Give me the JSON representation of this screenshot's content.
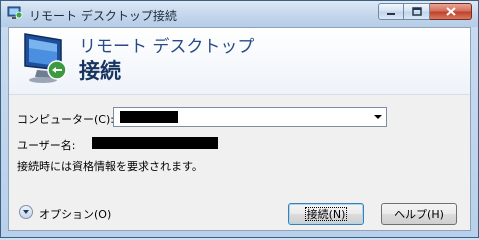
{
  "window": {
    "title": "リモート デスクトップ接続",
    "icon": "remote-desktop-icon"
  },
  "banner": {
    "title": "リモート デスクトップ",
    "subtitle": "接続",
    "icon": "computer-monitor-icon"
  },
  "form": {
    "computer_label": "コンピューター(C):",
    "computer_value": "",
    "username_label": "ユーザー名:",
    "username_value": "",
    "info_text": "接続時には資格情報を要求されます。"
  },
  "footer": {
    "options_label": "オプション(O)",
    "connect_label": "接続(N)",
    "help_label": "ヘルプ(H)"
  }
}
